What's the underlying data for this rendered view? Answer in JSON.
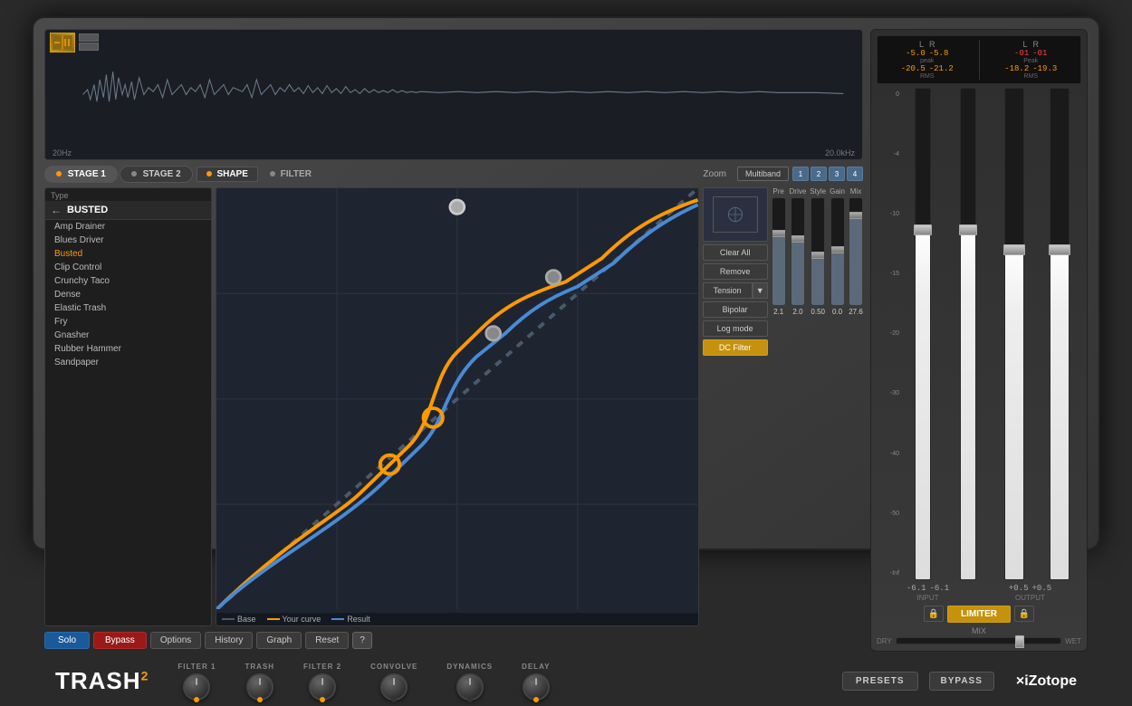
{
  "plugin": {
    "brand": "TRASH",
    "brand_super": "2",
    "izotope_logo": "×iZotope"
  },
  "waveform": {
    "freq_low": "20Hz",
    "freq_high": "20.0kHz"
  },
  "stages": {
    "stage1_label": "STAGE 1",
    "stage2_label": "STAGE 2"
  },
  "tabs": {
    "shape_label": "SHAPE",
    "filter_label": "FILTER",
    "zoom_label": "Zoom",
    "multiband_label": "Multiband",
    "bands": [
      "1",
      "2",
      "3",
      "4"
    ]
  },
  "preset_list": {
    "type_label": "Type",
    "current": "BUSTED",
    "items": [
      {
        "name": "Amp Drainer",
        "active": false
      },
      {
        "name": "Blues Driver",
        "active": false
      },
      {
        "name": "Busted",
        "active": true
      },
      {
        "name": "Clip Control",
        "active": false
      },
      {
        "name": "Crunchy Taco",
        "active": false
      },
      {
        "name": "Dense",
        "active": false
      },
      {
        "name": "Elastic Trash",
        "active": false
      },
      {
        "name": "Fry",
        "active": false
      },
      {
        "name": "Gnasher",
        "active": false
      },
      {
        "name": "Rubber Hammer",
        "active": false
      },
      {
        "name": "Sandpaper",
        "active": false
      }
    ]
  },
  "controls": {
    "clear_all": "Clear All",
    "remove": "Remove",
    "tension": "Tension",
    "bipolar": "Bipolar",
    "log_mode": "Log mode",
    "dc_filter": "DC Filter"
  },
  "curve_legend": {
    "base": "Base",
    "your_curve": "Your curve",
    "result": "Result"
  },
  "sliders": {
    "pre_label": "Pre",
    "drive_label": "Drive",
    "style_label": "Style",
    "gain_label": "Gain",
    "mix_label": "Mix",
    "pre_value": "2.1",
    "drive_value": "2.0",
    "style_value": "0.50",
    "gain_value": "0.0",
    "mix_value": "27.6"
  },
  "bottom_buttons": {
    "solo": "Solo",
    "bypass": "Bypass",
    "options": "Options",
    "history": "History",
    "graph": "Graph",
    "reset": "Reset",
    "help": "?"
  },
  "meters": {
    "left_label": "L",
    "right_label": "R",
    "left_label2": "L",
    "right_label2": "R",
    "peak_label": "Peak",
    "rms_label": "RMS",
    "peak_l": "-5.0",
    "peak_r": "-5.8",
    "rms_l": "-20.5",
    "rms_r": "-21.2",
    "peak2_l": "-01",
    "peak2_r": "-01",
    "rms2_l": "-18.2",
    "rms2_r": "-19.3"
  },
  "fader_scale": [
    "0",
    "-4",
    "-10",
    "-15",
    "-20",
    "-30",
    "-40",
    "-50",
    "-Inf"
  ],
  "io": {
    "input_val_l": "-6.1",
    "input_val_r": "-6.1",
    "input_label": "INPUT",
    "output_val_l": "+0.5",
    "output_val_r": "+0.5",
    "output_label": "OUTPUT"
  },
  "limiter": {
    "limiter_label": "LIMITER"
  },
  "mix_slider": {
    "label": "MIX",
    "dry_label": "DRY",
    "wet_label": "WET"
  },
  "modules": [
    {
      "label": "FILTER 1",
      "indicator": "orange"
    },
    {
      "label": "TRASH",
      "indicator": "orange"
    },
    {
      "label": "FILTER 2",
      "indicator": "orange"
    },
    {
      "label": "CONVOLVE",
      "indicator": "off"
    },
    {
      "label": "DYNAMICS",
      "indicator": "off"
    },
    {
      "label": "DELAY",
      "indicator": "orange"
    }
  ],
  "right_controls": {
    "presets": "PRESETS",
    "bypass": "BYPASS"
  }
}
